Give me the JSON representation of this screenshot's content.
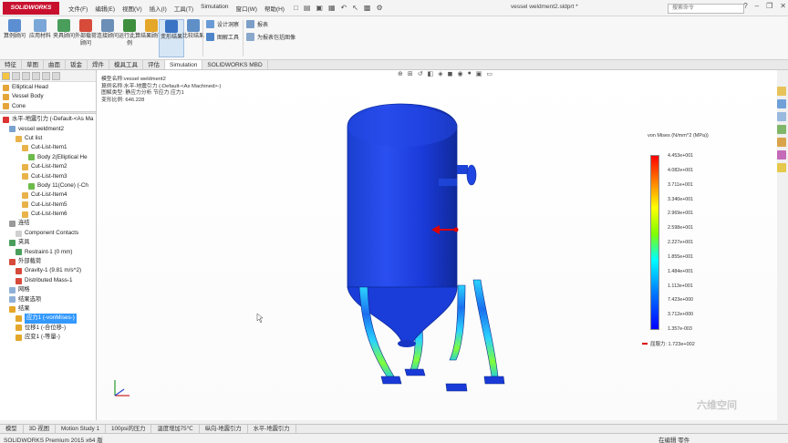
{
  "app": {
    "brand": "SOLIDWORKS",
    "document_title": "vessel weldment2.sldprt *",
    "search_placeholder": "搜索命令"
  },
  "menu": [
    "文件(F)",
    "编辑(E)",
    "视图(V)",
    "插入(I)",
    "工具(T)",
    "Simulation",
    "窗口(W)",
    "帮助(H)"
  ],
  "ribbon": {
    "buttons": [
      {
        "label": "算例顾问",
        "color": "#5b8fd1"
      },
      {
        "label": "应用材料",
        "color": "#7aa7d8"
      },
      {
        "label": "夹具顾问",
        "color": "#4a9e5c"
      },
      {
        "label": "外部载荷顾问",
        "color": "#d64b3a"
      },
      {
        "label": "连接顾问",
        "color": "#6c8fb8"
      },
      {
        "label": "运行此算例",
        "color": "#3f8f3f"
      },
      {
        "label": "结果顾问",
        "color": "#e4a72a"
      },
      {
        "label": "变形结果",
        "color": "#3a73c4"
      },
      {
        "label": "比较结果",
        "color": "#5f8fc7"
      }
    ],
    "small": [
      {
        "label": "设计洞察",
        "color": "#6a9bd6"
      },
      {
        "label": "图解工具",
        "color": "#4f86c9"
      },
      {
        "label": "报表",
        "color": "#7c9fc8"
      },
      {
        "label": "为报表包括图像",
        "color": "#8aa8cc"
      }
    ]
  },
  "command_tabs": [
    "特征",
    "草图",
    "曲面",
    "钣金",
    "焊件",
    "模具工具",
    "评估",
    "Simulation",
    "SOLIDWORKS MBD"
  ],
  "command_tab_active": "Simulation",
  "tree_top": [
    {
      "label": "Elliptical Head",
      "icon": "#e5a53a"
    },
    {
      "label": "Vessel Body",
      "icon": "#e5a53a"
    },
    {
      "label": "Cone",
      "icon": "#e5a53a"
    }
  ],
  "tree": [
    {
      "label": "水平-地震引力 (-Default-<As Ma",
      "indent": 0,
      "icon": "#d33"
    },
    {
      "label": "vessel weldment2",
      "indent": 1,
      "icon": "#7aa2cf"
    },
    {
      "label": "Cut list",
      "indent": 2,
      "icon": "#e8b34a"
    },
    {
      "label": "Cut-List-Item1",
      "indent": 3,
      "icon": "#e8b34a"
    },
    {
      "label": "Body 2(Elliptical He",
      "indent": 4,
      "icon": "#6dbb4a"
    },
    {
      "label": "Cut-List-Item2",
      "indent": 3,
      "icon": "#e8b34a"
    },
    {
      "label": "Cut-List-Item3",
      "indent": 3,
      "icon": "#e8b34a"
    },
    {
      "label": "Body 11(Cone) (-Ch",
      "indent": 4,
      "icon": "#6dbb4a"
    },
    {
      "label": "Cut-List-Item4",
      "indent": 3,
      "icon": "#e8b34a"
    },
    {
      "label": "Cut-List-Item5",
      "indent": 3,
      "icon": "#e8b34a"
    },
    {
      "label": "Cut-List-Item6",
      "indent": 3,
      "icon": "#e8b34a"
    },
    {
      "label": "连结",
      "indent": 1,
      "icon": "#9a9a9a"
    },
    {
      "label": "Component Contacts",
      "indent": 2,
      "icon": "#d0d0d0"
    },
    {
      "label": "夹具",
      "indent": 1,
      "icon": "#4a9e5c"
    },
    {
      "label": "Restraint-1 (0 mm)",
      "indent": 2,
      "icon": "#4a9e5c"
    },
    {
      "label": "外部载荷",
      "indent": 1,
      "icon": "#d64b3a"
    },
    {
      "label": "Gravity-1 (9.81 m/s^2)",
      "indent": 2,
      "icon": "#d64b3a"
    },
    {
      "label": "Distributed Mass-1",
      "indent": 2,
      "icon": "#d64b3a"
    },
    {
      "label": "网格",
      "indent": 1,
      "icon": "#8fb0d6"
    },
    {
      "label": "结果选项",
      "indent": 1,
      "icon": "#8fb0d6"
    },
    {
      "label": "结果",
      "indent": 1,
      "icon": "#e4a72a"
    },
    {
      "label": "应力1 (-vonMises-)",
      "indent": 2,
      "icon": "#e4a72a",
      "selected": true
    },
    {
      "label": "位移1 (-合位移-)",
      "indent": 2,
      "icon": "#e4a72a"
    },
    {
      "label": "应变1 (-等量-)",
      "indent": 2,
      "icon": "#e4a72a"
    }
  ],
  "plot_info": {
    "model_name": "模型名称:vessel weldment2",
    "study_name": "算例名称:水平-地震引力 (-Default-<As Machined>-)",
    "plot_type": "图解类型: 静应力分析 节应力 应力1",
    "deform_scale": "变形比例: 646.228"
  },
  "legend": {
    "title": "von Mises (N/mm^2 (MPa))",
    "ticks": [
      "4.453e+001",
      "4.082e+001",
      "3.711e+001",
      "3.340e+001",
      "2.969e+001",
      "2.598e+001",
      "2.227e+001",
      "1.855e+001",
      "1.484e+001",
      "1.113e+001",
      "7.423e+000",
      "3.712e+000",
      "1.357e-003"
    ],
    "yield_label": "屈服力: 1.723e+002"
  },
  "bottom_tabs": [
    "模型",
    "3D 视图",
    "Motion Study 1",
    "100psi的压力",
    "温度增加75℃",
    "纵向-地震引力",
    "水平-地震引力"
  ],
  "status": {
    "left": "SOLIDWORKS Premium 2015 x64 版",
    "right": "在编辑 零件"
  },
  "watermark": "六维空间"
}
